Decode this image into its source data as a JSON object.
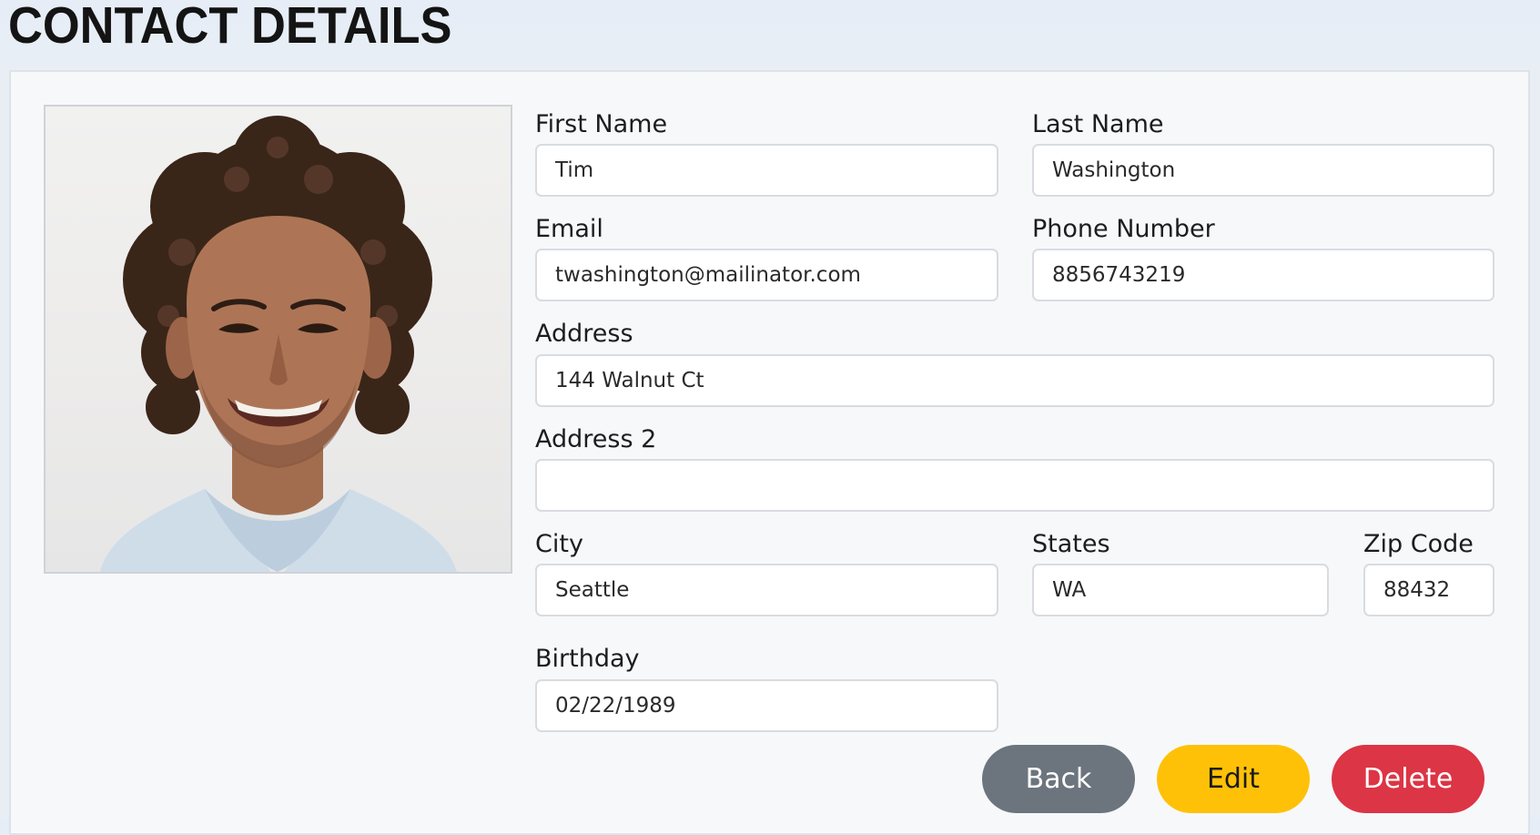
{
  "page": {
    "title": "CONTACT DETAILS"
  },
  "photo": {
    "icon": "contact-photo-person"
  },
  "form": {
    "first_name": {
      "label": "First Name",
      "value": "Tim"
    },
    "last_name": {
      "label": "Last Name",
      "value": "Washington"
    },
    "email": {
      "label": "Email",
      "value": "twashington@mailinator.com"
    },
    "phone": {
      "label": "Phone Number",
      "value": "8856743219"
    },
    "address": {
      "label": "Address",
      "value": "144 Walnut Ct"
    },
    "address2": {
      "label": "Address 2",
      "value": ""
    },
    "city": {
      "label": "City",
      "value": "Seattle"
    },
    "state": {
      "label": "States",
      "value": "WA"
    },
    "zip": {
      "label": "Zip Code",
      "value": "88432"
    },
    "birthday": {
      "label": "Birthday",
      "value": "02/22/1989"
    }
  },
  "actions": {
    "back_label": "Back",
    "edit_label": "Edit",
    "delete_label": "Delete"
  },
  "colors": {
    "back": "#6c757d",
    "edit": "#ffc107",
    "delete": "#dc3545"
  }
}
